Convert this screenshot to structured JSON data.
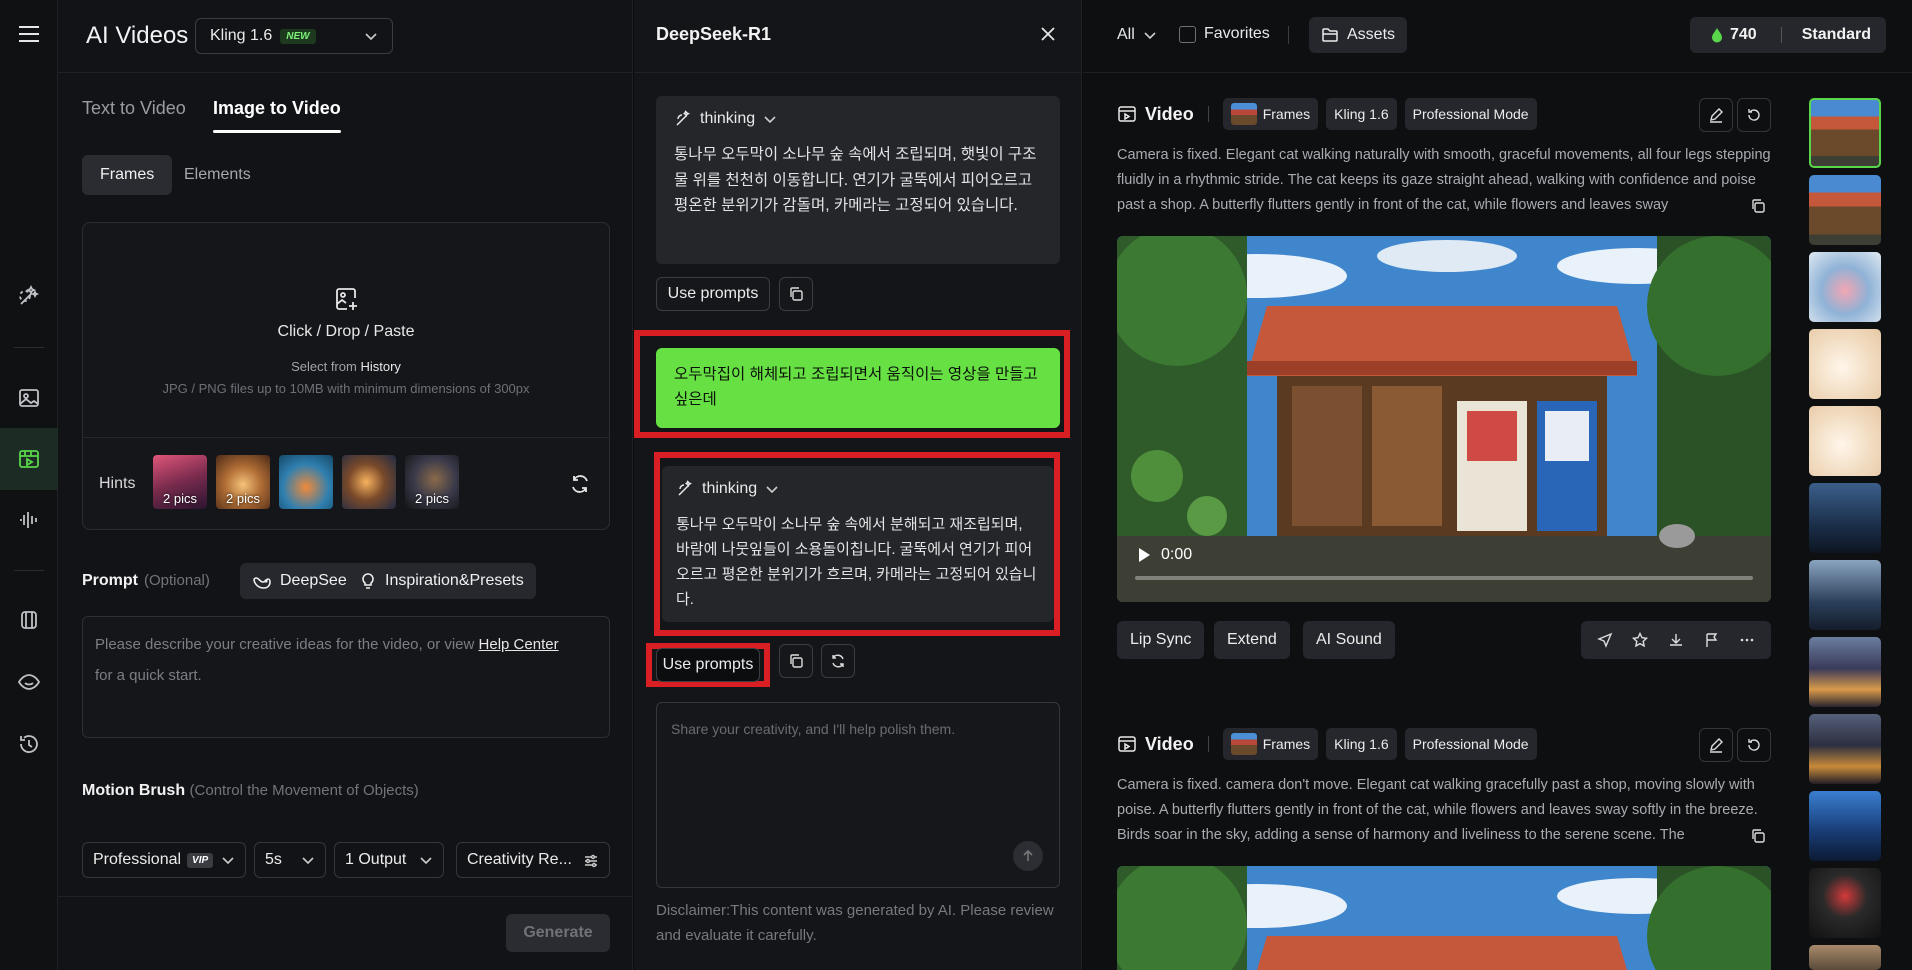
{
  "app": {
    "title": "AI Videos",
    "model_selector": {
      "label": "Kling 1.6",
      "badge": "NEW"
    }
  },
  "left": {
    "tabs": [
      {
        "label": "Text to Video",
        "active": false
      },
      {
        "label": "Image to Video",
        "active": true
      }
    ],
    "subtabs": [
      {
        "label": "Frames",
        "active": true
      },
      {
        "label": "Elements",
        "active": false
      }
    ],
    "upload": {
      "title": "Click / Drop / Paste",
      "select_from": "Select from",
      "history": "History",
      "spec": "JPG / PNG files up to 10MB with minimum dimensions of 300px"
    },
    "hints": {
      "label": "Hints",
      "items": [
        {
          "caption": "2 pics"
        },
        {
          "caption": "2 pics"
        },
        {
          "caption": ""
        },
        {
          "caption": ""
        },
        {
          "caption": "2 pics"
        }
      ]
    },
    "prompt": {
      "label": "Prompt",
      "optional": "(Optional)",
      "deepseek": "DeepSeek",
      "inspiration": "Inspiration&Presets",
      "placeholder_before": "Please describe your creative ideas for the video, or view",
      "help_link": "Help Center",
      "placeholder_after": "for a quick start."
    },
    "motion_brush": {
      "label": "Motion Brush",
      "hint": "(Control the Movement of Objects)"
    },
    "options": {
      "mode": "Professional",
      "mode_badge": "VIP",
      "duration": "5s",
      "outputs": "1 Output",
      "creativity": "Creativity Re..."
    },
    "generate": "Generate"
  },
  "chat": {
    "title": "DeepSeek-R1",
    "thinking_label": "thinking",
    "messages": [
      {
        "type": "assistant",
        "text": "통나무 오두막이 소나무 숲 속에서 조립되며, 햇빛이 구조물 위를 천천히 이동합니다. 연기가 굴뚝에서 피어오르고 평온한 분위기가 감돌며, 카메라는 고정되어 있습니다."
      },
      {
        "type": "user",
        "text": "오두막집이 해체되고 조립되면서 움직이는 영상을 만들고 싶은데"
      },
      {
        "type": "assistant",
        "text": "통나무 오두막이 소나무 숲 속에서 분해되고 재조립되며, 바람에 나뭇잎들이 소용돌이칩니다. 굴뚝에서 연기가 피어오르고 평온한 분위기가 흐르며, 카메라는 고정되어 있습니다."
      }
    ],
    "use_prompts": "Use prompts",
    "input_placeholder": "Share your creativity, and I'll help polish them.",
    "disclaimer": "Disclaimer:This content was generated by AI. Please review and evaluate it carefully."
  },
  "right": {
    "filter": "All",
    "favorites": "Favorites",
    "assets": "Assets",
    "credits": "740",
    "plan": "Standard",
    "videos": [
      {
        "type": "Video",
        "tags": [
          "Frames",
          "Kling 1.6",
          "Professional Mode"
        ],
        "description": "Camera is fixed. Elegant cat walking naturally with smooth, graceful movements, all four legs stepping fluidly in a rhythmic stride. The cat keeps its gaze straight ahead, walking with confidence and poise past a shop. A butterfly flutters gently in front of the cat, while flowers and leaves sway",
        "time": "0:00",
        "actions": [
          "Lip Sync",
          "Extend",
          "AI Sound"
        ]
      },
      {
        "type": "Video",
        "tags": [
          "Frames",
          "Kling 1.6",
          "Professional Mode"
        ],
        "description": "Camera is fixed. camera don't move. Elegant cat walking gracefully past a shop, moving slowly with poise. A butterfly flutters gently in front of the cat, while flowers and leaves sway softly in the breeze. Birds soar in the sky, adding a sense of harmony and liveliness to the serene scene. The"
      }
    ]
  },
  "colors": {
    "accent_green": "#66e043",
    "highlight_red": "#d91e24"
  }
}
